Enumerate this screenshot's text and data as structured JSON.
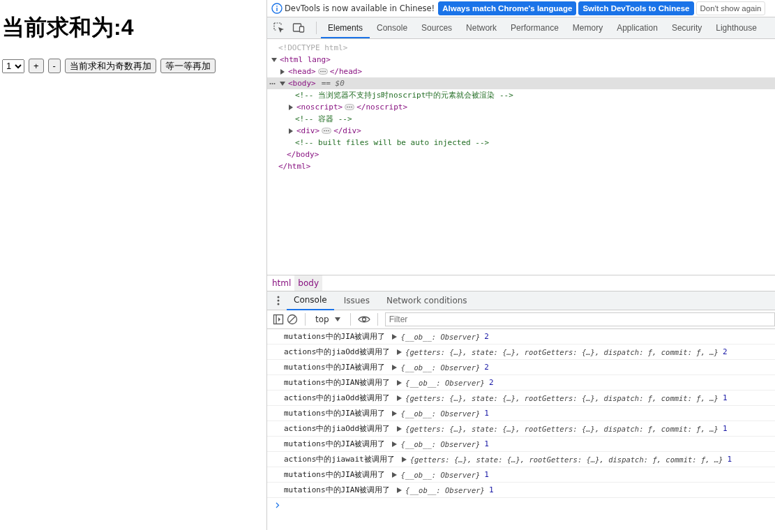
{
  "page": {
    "heading": "当前求和为:4",
    "select_value": "1",
    "buttons": [
      "+",
      "-",
      "当前求和为奇数再加",
      "等一等再加"
    ]
  },
  "devtools": {
    "banner": {
      "message": "DevTools is now available in Chinese!",
      "buttons": [
        {
          "label": "Always match Chrome's language",
          "kind": "primary"
        },
        {
          "label": "Switch DevTools to Chinese",
          "kind": "primary"
        },
        {
          "label": "Don't show again",
          "kind": "secondary"
        }
      ]
    },
    "tabs": [
      {
        "label": "Elements",
        "selected": true
      },
      {
        "label": "Console",
        "selected": false
      },
      {
        "label": "Sources",
        "selected": false
      },
      {
        "label": "Network",
        "selected": false
      },
      {
        "label": "Performance",
        "selected": false
      },
      {
        "label": "Memory",
        "selected": false
      },
      {
        "label": "Application",
        "selected": false
      },
      {
        "label": "Security",
        "selected": false
      },
      {
        "label": "Lighthouse",
        "selected": false
      }
    ],
    "elements": [
      {
        "kind": "doctype",
        "text": "<!DOCTYPE html>"
      },
      {
        "kind": "element",
        "open": "<html lang>",
        "close": "</html>",
        "expanded": true,
        "selected": false,
        "children": [
          {
            "kind": "element",
            "open": "<head>",
            "close": "</head>",
            "expanded": false,
            "selected": false
          },
          {
            "kind": "element",
            "open": "<body>",
            "close": "</body>",
            "expanded": true,
            "selected": true,
            "marker": "== $0",
            "children": [
              {
                "kind": "comment",
                "text": "<!-- 当浏览器不支持js时noscript中的元素就会被渲染 -->"
              },
              {
                "kind": "element",
                "open": "<noscript>",
                "close": "</noscript>",
                "expanded": false,
                "selected": false
              },
              {
                "kind": "comment",
                "text": "<!-- 容器 -->"
              },
              {
                "kind": "element",
                "open": "<div>",
                "close": "</div>",
                "expanded": false,
                "selected": false
              },
              {
                "kind": "comment",
                "text": "<!-- built files will be auto injected -->"
              }
            ]
          }
        ]
      }
    ],
    "breadcrumbs": [
      {
        "label": "html",
        "selected": false
      },
      {
        "label": "body",
        "selected": true
      }
    ],
    "drawer_tabs": [
      {
        "label": "Console",
        "selected": true
      },
      {
        "label": "Issues",
        "selected": false
      },
      {
        "label": "Network conditions",
        "selected": false
      }
    ],
    "context": "top",
    "filter_placeholder": "Filter",
    "logs": [
      {
        "message": "mutations中的JIA被调用了",
        "preview": "{__ob__: Observer}",
        "value": "2"
      },
      {
        "message": "actions中的jiaOdd被调用了",
        "preview": "{getters: {…}, state: {…}, rootGetters: {…}, dispatch: ƒ, commit: ƒ, …}",
        "value": "2"
      },
      {
        "message": "mutations中的JIA被调用了",
        "preview": "{__ob__: Observer}",
        "value": "2"
      },
      {
        "message": "mutations中的JIAN被调用了",
        "preview": "{__ob__: Observer}",
        "value": "2"
      },
      {
        "message": "actions中的jiaOdd被调用了",
        "preview": "{getters: {…}, state: {…}, rootGetters: {…}, dispatch: ƒ, commit: ƒ, …}",
        "value": "1"
      },
      {
        "message": "mutations中的JIA被调用了",
        "preview": "{__ob__: Observer}",
        "value": "1"
      },
      {
        "message": "actions中的jiaOdd被调用了",
        "preview": "{getters: {…}, state: {…}, rootGetters: {…}, dispatch: ƒ, commit: ƒ, …}",
        "value": "1"
      },
      {
        "message": "mutations中的JIA被调用了",
        "preview": "{__ob__: Observer}",
        "value": "1"
      },
      {
        "message": "actions中的jiawait被调用了",
        "preview": "{getters: {…}, state: {…}, rootGetters: {…}, dispatch: ƒ, commit: ƒ, …}",
        "value": "1"
      },
      {
        "message": "mutations中的JIA被调用了",
        "preview": "{__ob__: Observer}",
        "value": "1"
      },
      {
        "message": "mutations中的JIAN被调用了",
        "preview": "{__ob__: Observer}",
        "value": "1"
      }
    ]
  }
}
